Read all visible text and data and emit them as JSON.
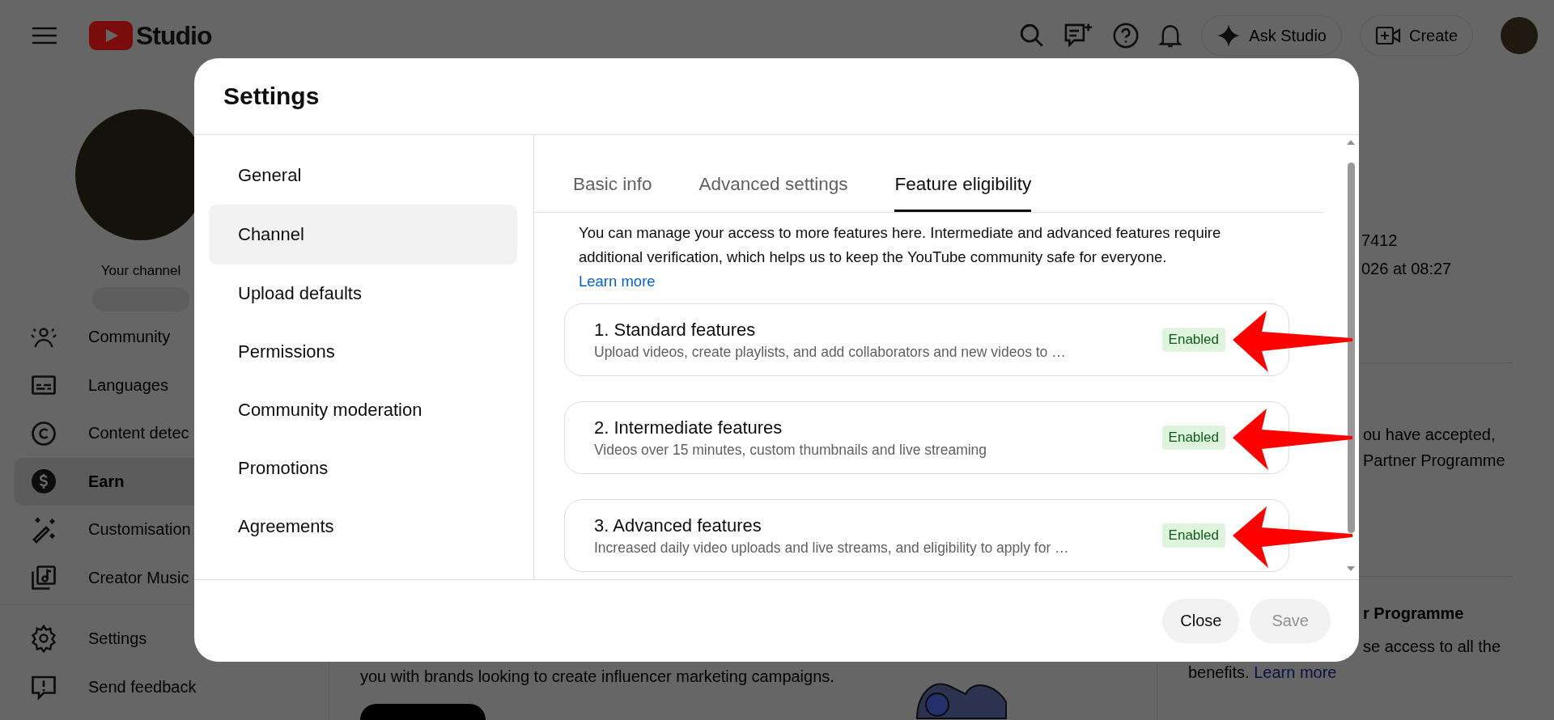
{
  "header": {
    "logo_text": "Studio",
    "ask_button": "Ask Studio",
    "create_button": "Create"
  },
  "sidebar": {
    "channel_label": "Your channel",
    "items": [
      {
        "label": "Community",
        "kind": "community",
        "selected": false
      },
      {
        "label": "Languages",
        "kind": "languages",
        "selected": false
      },
      {
        "label": "Content detec",
        "kind": "copyright",
        "selected": false
      },
      {
        "label": "Earn",
        "kind": "earn",
        "selected": true
      },
      {
        "label": "Customisation",
        "kind": "wand",
        "selected": false
      },
      {
        "label": "Creator Music",
        "kind": "music",
        "selected": false
      }
    ],
    "footer_items": [
      {
        "label": "Settings",
        "kind": "settings",
        "selected": false
      },
      {
        "label": "Send feedback",
        "kind": "feedback",
        "selected": false
      }
    ]
  },
  "background": {
    "right_lines": [
      "7412",
      "026 at 08:27"
    ],
    "right_lines_2": [
      "ou have accepted,",
      "Partner Programme"
    ],
    "programme_title": "r Programme",
    "programme_text": "se access to all the",
    "benefits_text": "benefits.",
    "benefits_link": "Learn more",
    "bottom_text": "you with brands looking to create influencer marketing campaigns."
  },
  "dialog": {
    "title": "Settings",
    "nav": [
      {
        "label": "General",
        "selected": false
      },
      {
        "label": "Channel",
        "selected": true
      },
      {
        "label": "Upload defaults",
        "selected": false
      },
      {
        "label": "Permissions",
        "selected": false
      },
      {
        "label": "Community moderation",
        "selected": false
      },
      {
        "label": "Promotions",
        "selected": false
      },
      {
        "label": "Agreements",
        "selected": false
      }
    ],
    "tabs": [
      {
        "label": "Basic info",
        "selected": false
      },
      {
        "label": "Advanced settings",
        "selected": false
      },
      {
        "label": "Feature eligibility",
        "selected": true
      }
    ],
    "intro": "You can manage your access to more features here. Intermediate and advanced features require additional verification, which helps us to keep the YouTube community safe for everyone.",
    "intro_link": "Learn more",
    "features": [
      {
        "title": "1. Standard features",
        "description": "Upload videos, create playlists, and add collaborators and new videos to …",
        "status": "Enabled",
        "annotated": true
      },
      {
        "title": "2. Intermediate features",
        "description": "Videos over 15 minutes, custom thumbnails and live streaming",
        "status": "Enabled",
        "annotated": true
      },
      {
        "title": "3. Advanced features",
        "description": "Increased daily video uploads and live streams, and eligibility to apply for …",
        "status": "Enabled",
        "annotated": true
      }
    ],
    "buttons": [
      {
        "label": "Close",
        "disabled": false
      },
      {
        "label": "Save",
        "disabled": true
      }
    ]
  }
}
